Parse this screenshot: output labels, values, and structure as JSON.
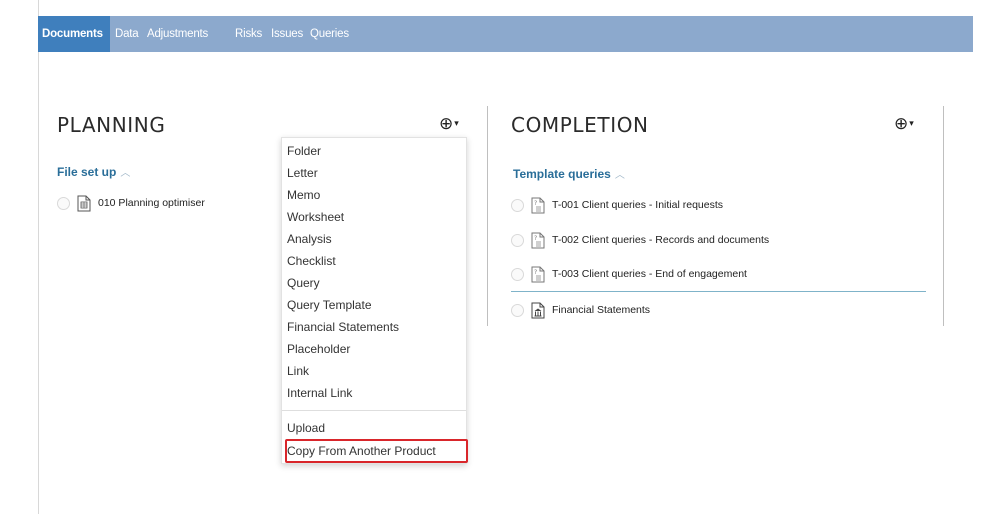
{
  "nav": {
    "tabs": [
      {
        "label": "Documents",
        "active": true
      },
      {
        "label": "Data"
      },
      {
        "label": "Adjustments"
      },
      {
        "label": "Risks"
      },
      {
        "label": "Issues"
      },
      {
        "label": "Queries"
      }
    ]
  },
  "planning": {
    "title": "PLANNING",
    "add_icon": "circle-plus-icon",
    "sections": [
      {
        "label": "File set up",
        "items": [
          {
            "label": "010 Planning optimiser",
            "icon": "document-icon"
          }
        ]
      }
    ]
  },
  "completion": {
    "title": "COMPLETION",
    "add_icon": "circle-plus-icon",
    "sections": [
      {
        "label": "Template queries",
        "items": [
          {
            "label": "T-001 Client queries - Initial requests",
            "icon": "query-document-icon"
          },
          {
            "label": "T-002 Client queries - Records and documents",
            "icon": "query-document-icon"
          },
          {
            "label": "T-003 Client queries - End of engagement",
            "icon": "query-document-icon"
          }
        ]
      },
      {
        "label": "",
        "items": [
          {
            "label": "Financial Statements",
            "icon": "financial-statements-icon"
          }
        ]
      }
    ]
  },
  "add_menu": {
    "items": [
      "Folder",
      "Letter",
      "Memo",
      "Worksheet",
      "Analysis",
      "Checklist",
      "Query",
      "Query Template",
      "Financial Statements",
      "Placeholder",
      "Link",
      "Internal Link"
    ],
    "secondary_items": [
      "Upload",
      "Copy From Another Product"
    ],
    "highlighted": "Copy From Another Product"
  },
  "colors": {
    "nav_bg": "#8ca9cd",
    "nav_active": "#3f7fbd",
    "section_link": "#2a6e99",
    "highlight_border": "#d9262b"
  }
}
